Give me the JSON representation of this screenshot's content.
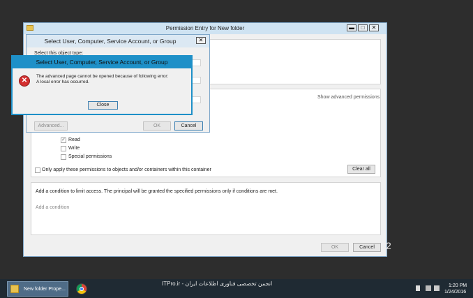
{
  "permission_window": {
    "title": "Permission Entry for New folder",
    "controls": {
      "minimize": "▬",
      "maximize": "□",
      "close": "✕"
    },
    "permissions": {
      "read": {
        "label": "Read",
        "checked": true
      },
      "write": {
        "label": "Write",
        "checked": false
      },
      "special": {
        "label": "Special permissions",
        "checked": false
      }
    },
    "show_advanced_link": "Show advanced permissions",
    "apply_only_label": "Only apply these permissions to objects and/or containers within this container",
    "clear_all_button": "Clear all",
    "condition_text": "Add a condition to limit access. The principal will be granted the specified permissions only if conditions are met.",
    "add_condition_link": "Add a condition",
    "ok_button": "OK",
    "cancel_button": "Cancel"
  },
  "select_dialog": {
    "title": "Select User, Computer, Service Account, or Group",
    "close_icon": "✕",
    "select_object_type_label": "Select this object type:",
    "advanced_button": "Advanced...",
    "ok_button": "OK",
    "cancel_button": "Cancel"
  },
  "error_dialog": {
    "title": "Select User, Computer, Service Account, or Group",
    "message_line1": "The advanced page cannot be opened because of following error:",
    "message_line2": "A local error has occurred.",
    "close_button": "Close",
    "icon": "error-icon"
  },
  "taskbar": {
    "app_label": "New folder Prope...",
    "watermark": "ITPro.ir - انجمن تخصصی فناوری اطلاعات ایران",
    "time": "1:20 PM",
    "date": "1/24/2016"
  },
  "colors": {
    "accent": "#1e90c8",
    "error": "#d32f2f",
    "taskbar": "#1f2a33"
  }
}
